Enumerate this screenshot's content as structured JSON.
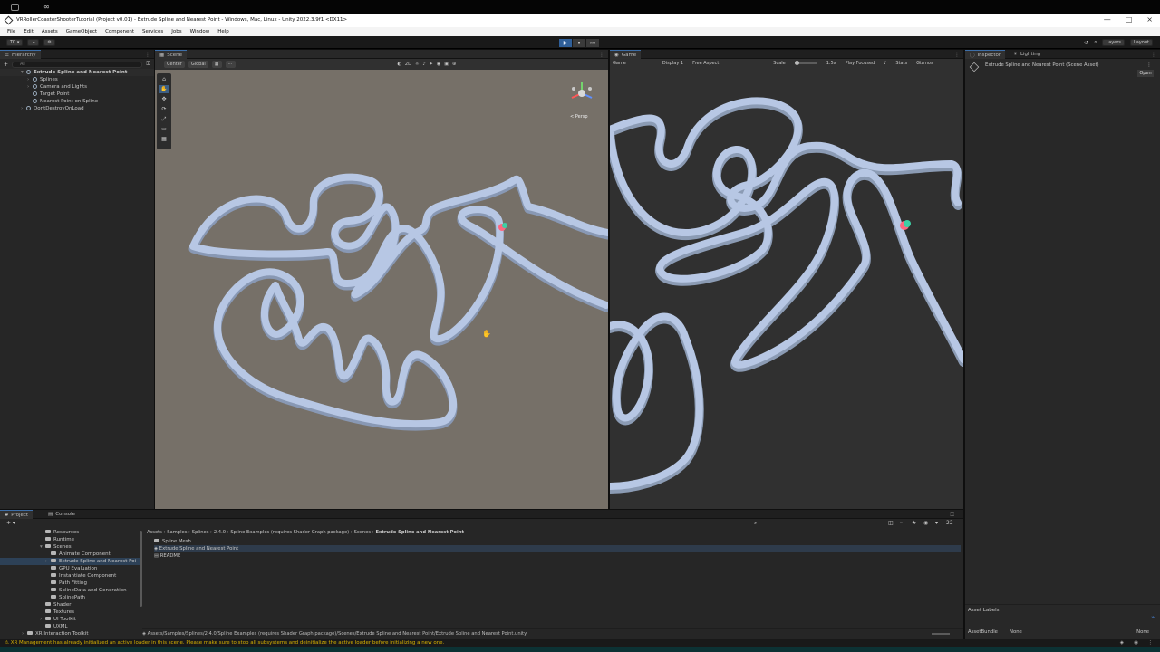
{
  "window": {
    "title": "VRRollerCoasterShooterTutorial (Project v0.01) - Extrude Spline and Nearest Point - Windows, Mac, Linux - Unity 2022.3.9f1 <DX11>",
    "controls": [
      "—",
      "□",
      "×"
    ]
  },
  "menubar": {
    "items": [
      "File",
      "Edit",
      "Assets",
      "GameObject",
      "Component",
      "Services",
      "Jobs",
      "Window",
      "Help"
    ]
  },
  "toolbar": {
    "left_buttons": [
      "TC ▾",
      "☁",
      "⚙"
    ],
    "play_controls": [
      "▶",
      "⏸",
      "⏭"
    ],
    "layers_label": "Layers",
    "layout_label": "Layout"
  },
  "hierarchy": {
    "tab_label": "Hierarchy",
    "search_placeholder": "All",
    "items": [
      {
        "label": "Extrude Spline and Nearest Point",
        "depth": 0,
        "bold": true
      },
      {
        "label": "Splines",
        "depth": 1
      },
      {
        "label": "Camera and Lights",
        "depth": 1
      },
      {
        "label": "Target Point",
        "depth": 1
      },
      {
        "label": "Nearest Point on Spline",
        "depth": 1
      },
      {
        "label": "DontDestroyOnLoad",
        "depth": 0
      }
    ]
  },
  "scene": {
    "tab_label": "Scene",
    "center_label": "Center",
    "global_label": "Global",
    "mode_2d": "2D",
    "persp_label": "< Persp"
  },
  "game": {
    "tab_label": "Game",
    "mode_label": "Game",
    "display_label": "Display 1",
    "aspect_label": "Free Aspect",
    "scale_label": "Scale",
    "scale_value": "1.5x",
    "focus_label": "Play Focused",
    "stats_label": "Stats",
    "gizmos_label": "Gizmos"
  },
  "inspector": {
    "tab_label": "Inspector",
    "lighting_tab": "Lighting",
    "asset_title": "Extrude Spline and Nearest Point (Scene Asset)",
    "open_button": "Open",
    "asset_labels": "Asset Labels",
    "asset_bundle_label": "AssetBundle",
    "asset_bundle_value": "None",
    "asset_bundle_variant": "None"
  },
  "project": {
    "tab_label": "Project",
    "console_tab": "Console",
    "tree": [
      {
        "label": "Resources",
        "depth": 2
      },
      {
        "label": "Runtime",
        "depth": 2
      },
      {
        "label": "Scenes",
        "depth": 2
      },
      {
        "label": "Animate Component",
        "depth": 3
      },
      {
        "label": "Extrude Spline and Nearest Poi",
        "depth": 3,
        "selected": true
      },
      {
        "label": "GPU Evaluation",
        "depth": 3
      },
      {
        "label": "Instantiate Component",
        "depth": 3
      },
      {
        "label": "Path Fitting",
        "depth": 3
      },
      {
        "label": "SplineData and Generation",
        "depth": 3
      },
      {
        "label": "SplinePath",
        "depth": 3
      },
      {
        "label": "Shader",
        "depth": 2
      },
      {
        "label": "Textures",
        "depth": 2
      },
      {
        "label": "UI Toolkit",
        "depth": 2
      },
      {
        "label": "UXML",
        "depth": 2
      },
      {
        "label": "XR Interaction Toolkit",
        "depth": 1
      }
    ],
    "breadcrumb": [
      "Assets",
      "Samples",
      "Splines",
      "2.4.0",
      "Spline Examples (requires Shader Graph package)",
      "Scenes",
      "Extrude Spline and Nearest Point"
    ],
    "files": [
      {
        "label": "Spline Mesh",
        "type": "folder"
      },
      {
        "label": "Extrude Spline and Nearest Point",
        "type": "scene",
        "selected": true
      },
      {
        "label": "README",
        "type": "file"
      }
    ],
    "selected_path": "Assets/Samples/Splines/2.4.0/Spline Examples (requires Shader Graph package)/Scenes/Extrude Spline and Nearest Point/Extrude Spline and Nearest Point.unity",
    "count_badge": "22"
  },
  "status": {
    "message": "XR Management has already initialized an active loader in this scene. Please make sure to stop all subsystems and deinitialize the active loader before initializing a new one."
  },
  "colors": {
    "accent": "#3d6ea8",
    "scene_background": "#767068",
    "game_background": "#303030",
    "spline": "#b7c7e4",
    "spline_shadow": "#8898b4",
    "target_point": "#ff6680",
    "nearest_point": "#3dcfa5",
    "warning": "#d8b100"
  }
}
